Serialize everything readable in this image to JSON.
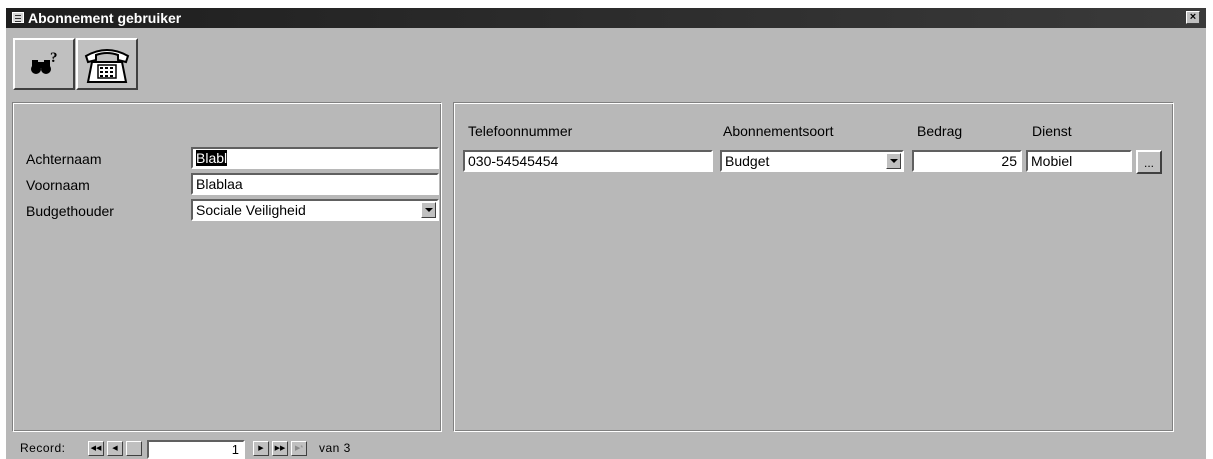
{
  "window": {
    "title": "Abonnement gebruiker",
    "close_glyph": "×"
  },
  "toolbar": {
    "find_icon": "binoculars-question-icon",
    "phone_icon": "telephone-icon"
  },
  "left_panel": {
    "fields": [
      {
        "label": "Achternaam",
        "value": "Blabl"
      },
      {
        "label": "Voornaam",
        "value": "Blablaa"
      },
      {
        "label": "Budgethouder",
        "value": "Sociale Veiligheid"
      }
    ]
  },
  "right_panel": {
    "headers": [
      "Telefoonnummer",
      "Abonnementsoort",
      "Bedrag",
      "Dienst"
    ],
    "row": {
      "telefoonnummer": "030-54545454",
      "abonnementsoort": "Budget",
      "bedrag": "25",
      "dienst": "Mobiel",
      "dienst_button": "..."
    }
  },
  "record_nav": {
    "label": "Record:",
    "current": "1",
    "of_text": "van 3"
  }
}
